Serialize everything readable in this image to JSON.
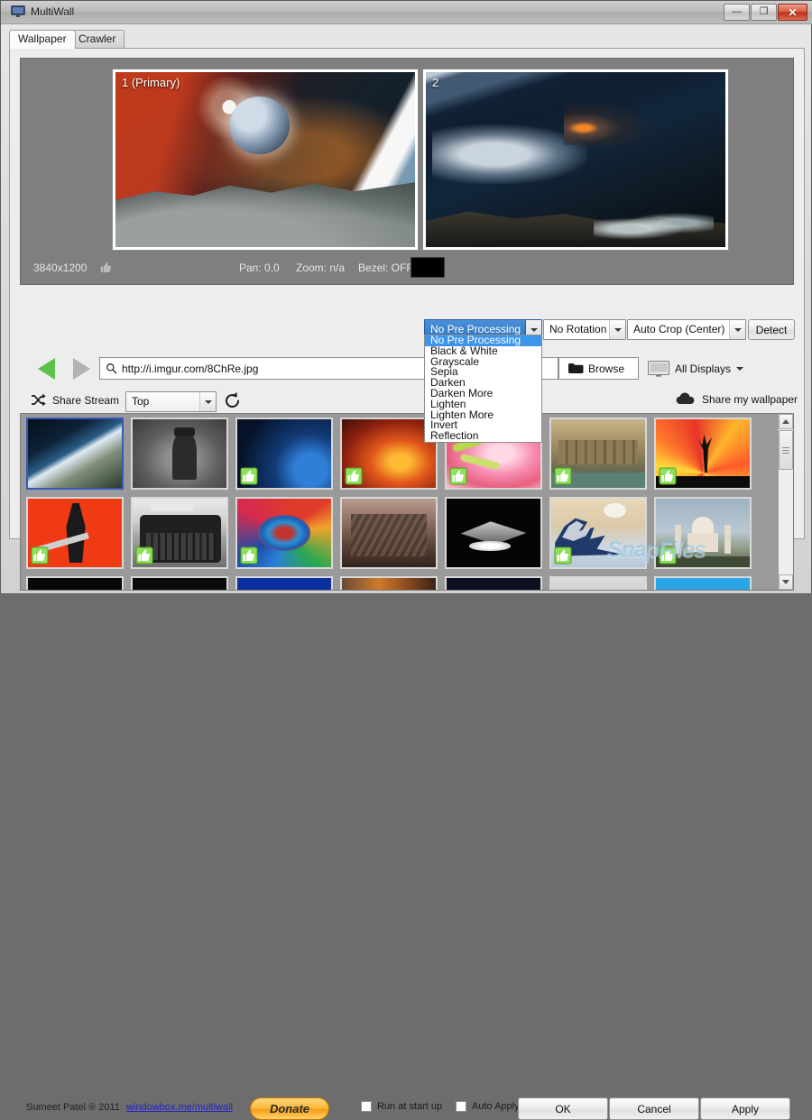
{
  "window": {
    "title": "MultiWall",
    "icon": "monitor-icon",
    "minimize_label": "—",
    "maximize_label": "❐",
    "close_label": "✕"
  },
  "tabs": [
    {
      "label": "Wallpaper",
      "active": true
    },
    {
      "label": "Crawler",
      "active": false
    }
  ],
  "preview": {
    "monitors": [
      {
        "label": "1 (Primary)"
      },
      {
        "label": "2"
      }
    ],
    "resolution": "3840x1200",
    "pan": "Pan: 0,0",
    "zoom": "Zoom: n/a",
    "bezel": "Bezel: OFF",
    "bezel_color": "#000000"
  },
  "controls": {
    "preprocessing": {
      "selected": "No Pre Processing",
      "open": true,
      "options": [
        "No Pre Processing",
        "Black & White",
        "Grayscale",
        "Sepia",
        "Darken",
        "Darken More",
        "Lighten",
        "Lighten More",
        "Invert",
        "Reflection"
      ]
    },
    "rotation": {
      "selected": "No Rotation"
    },
    "crop": {
      "selected": "Auto Crop (Center)"
    },
    "detect_label": "Detect"
  },
  "urlbar": {
    "value": "http://i.imgur.com/8ChRe.jpg",
    "search_icon": "search-icon",
    "back_label": "◀",
    "forward_label": "▶",
    "browse_label": "Browse",
    "displays_label": "All Displays"
  },
  "stream": {
    "shuffle_icon": "shuffle-icon",
    "label": "Share Stream",
    "selected": "Top",
    "refresh_icon": "refresh-icon",
    "share_label": "Share my wallpaper"
  },
  "gallery": {
    "rows": [
      [
        {
          "name": "earth-horizon",
          "selected": true,
          "liked": false
        },
        {
          "name": "rorschach",
          "selected": false,
          "liked": false
        },
        {
          "name": "blue-planet",
          "selected": false,
          "liked": true
        },
        {
          "name": "fire-dragon",
          "selected": false,
          "liked": true
        },
        {
          "name": "pink-lily",
          "selected": false,
          "liked": true
        },
        {
          "name": "roman-bath",
          "selected": false,
          "liked": true
        },
        {
          "name": "safari-tree",
          "selected": false,
          "liked": true
        }
      ],
      [
        {
          "name": "death-knight",
          "selected": false,
          "liked": true
        },
        {
          "name": "typewriter",
          "selected": false,
          "liked": true
        },
        {
          "name": "paint-swirl",
          "selected": false,
          "liked": true
        },
        {
          "name": "ruined-city",
          "selected": false,
          "liked": false
        },
        {
          "name": "star-destroyer",
          "selected": false,
          "liked": false
        },
        {
          "name": "great-wave",
          "selected": false,
          "liked": true
        },
        {
          "name": "taj-mahal",
          "selected": false,
          "liked": true
        }
      ],
      [
        {
          "name": "dark-strip-1",
          "selected": false,
          "liked": false
        },
        {
          "name": "dark-strip-2",
          "selected": false,
          "liked": false
        },
        {
          "name": "blue-strip",
          "selected": false,
          "liked": false
        },
        {
          "name": "ember-strip",
          "selected": false,
          "liked": false
        },
        {
          "name": "night-strip",
          "selected": false,
          "liked": false
        },
        {
          "name": "globe-strip",
          "selected": false,
          "liked": false
        },
        {
          "name": "sky-strip",
          "selected": false,
          "liked": false
        }
      ]
    ]
  },
  "watermark": "SnapFiles",
  "footer": {
    "copyright": "Sumeet Patel ® 2011",
    "link": "windowbox.me/multiwall",
    "donate_label": "Donate",
    "run_at_startup_label": "Run at start up",
    "auto_apply_label": "Auto Apply",
    "ok_label": "OK",
    "cancel_label": "Cancel",
    "apply_label": "Apply"
  }
}
